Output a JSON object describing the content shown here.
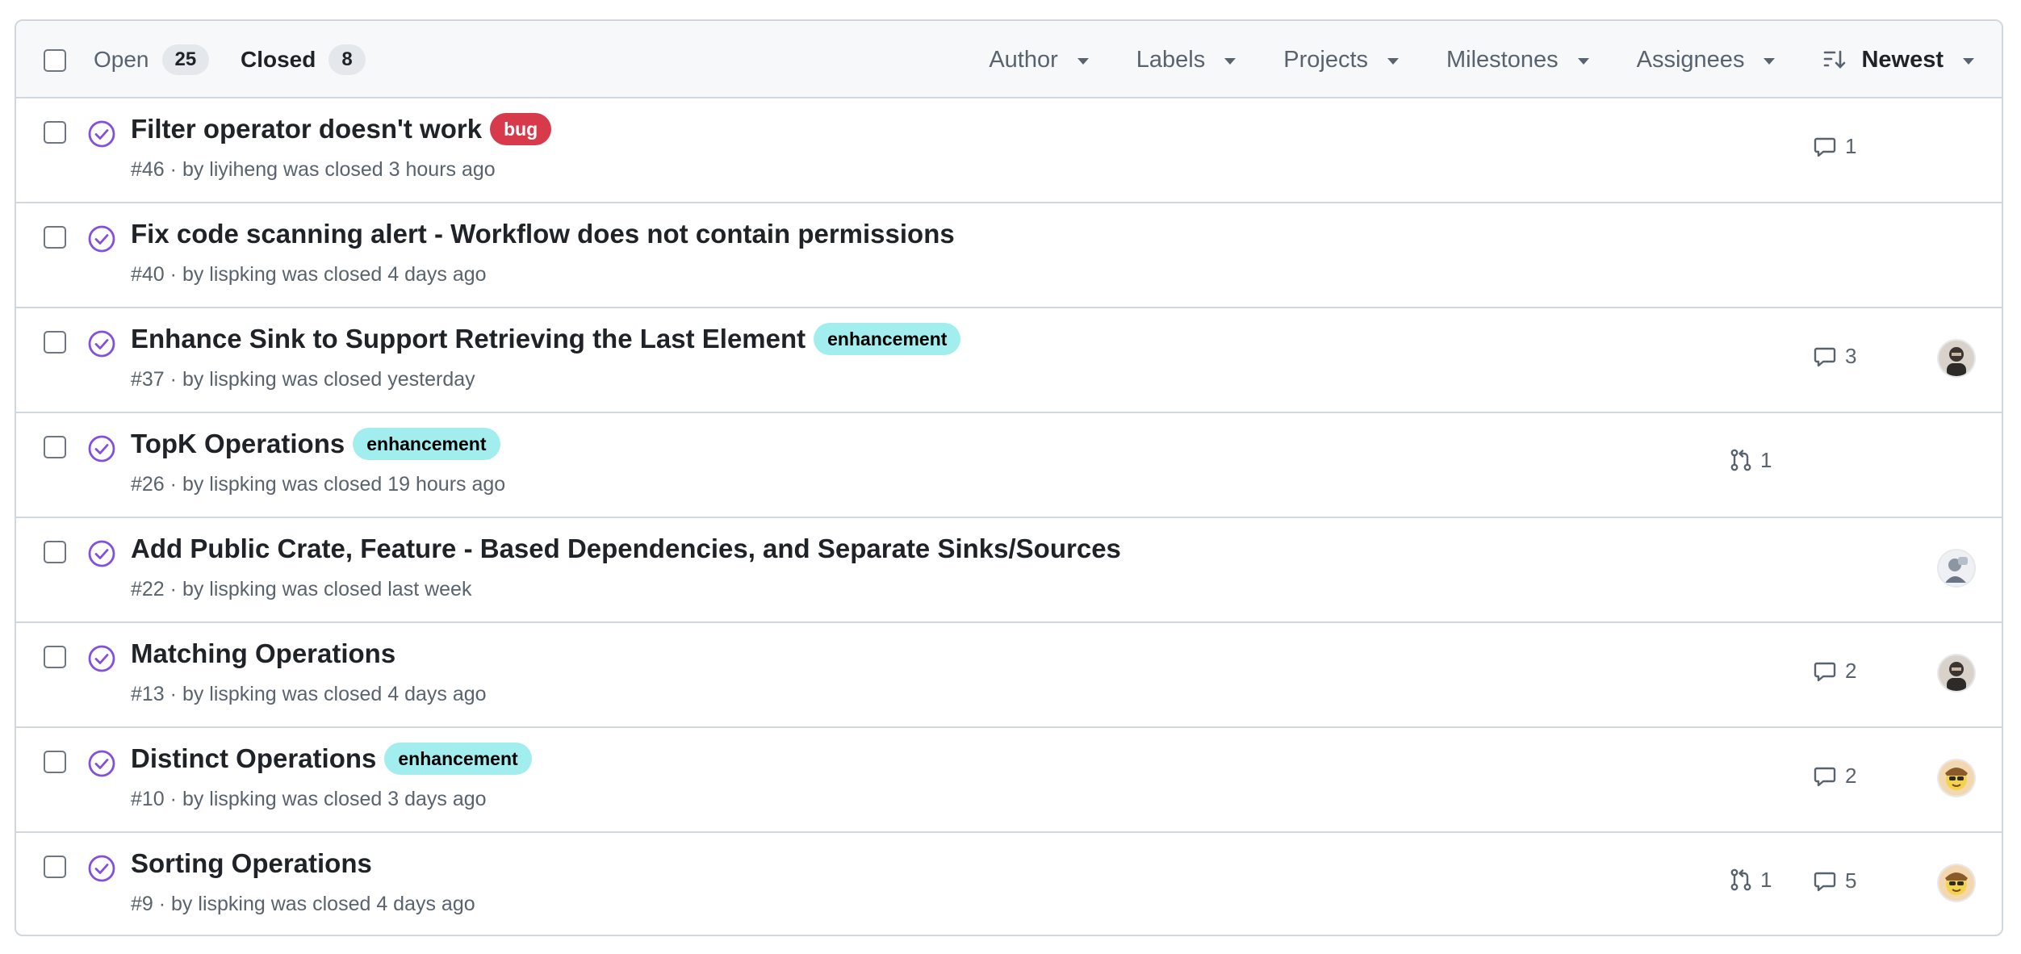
{
  "header": {
    "open": {
      "label": "Open",
      "count": "25"
    },
    "closed": {
      "label": "Closed",
      "count": "8"
    },
    "filters": [
      {
        "label": "Author"
      },
      {
        "label": "Labels"
      },
      {
        "label": "Projects"
      },
      {
        "label": "Milestones"
      },
      {
        "label": "Assignees"
      }
    ],
    "sort": {
      "label": "Newest",
      "icon": "sort-desc-icon"
    }
  },
  "label_colors": {
    "bug": {
      "bg": "#d73a4a",
      "fg": "#ffffff"
    },
    "enhancement": {
      "bg": "#a2eeef",
      "fg": "#000000"
    }
  },
  "status_color": "#8250df",
  "issues": [
    {
      "title": "Filter operator doesn't work",
      "label": "bug",
      "number": "#46",
      "by": "by",
      "author": "liyiheng",
      "closed_text": "was closed 3 hours ago",
      "prs": null,
      "comments": "1",
      "avatar": null
    },
    {
      "title": "Fix code scanning alert - Workflow does not contain permissions",
      "label": null,
      "number": "#40",
      "by": "by",
      "author": "lispking",
      "closed_text": "was closed 4 days ago",
      "prs": null,
      "comments": null,
      "avatar": null
    },
    {
      "title": "Enhance Sink to Support Retrieving the Last Element",
      "label": "enhancement",
      "number": "#37",
      "by": "by",
      "author": "lispking",
      "closed_text": "was closed yesterday",
      "prs": null,
      "comments": "3",
      "avatar": "dark"
    },
    {
      "title": "TopK Operations",
      "label": "enhancement",
      "number": "#26",
      "by": "by",
      "author": "lispking",
      "closed_text": "was closed 19 hours ago",
      "prs": "1",
      "comments": null,
      "avatar": null
    },
    {
      "title": "Add Public Crate, Feature - Based Dependencies, and Separate Sinks/Sources",
      "label": null,
      "number": "#22",
      "by": "by",
      "author": "lispking",
      "closed_text": "was closed last week",
      "prs": null,
      "comments": null,
      "avatar": "grey"
    },
    {
      "title": "Matching Operations",
      "label": null,
      "number": "#13",
      "by": "by",
      "author": "lispking",
      "closed_text": "was closed 4 days ago",
      "prs": null,
      "comments": "2",
      "avatar": "dark"
    },
    {
      "title": "Distinct Operations",
      "label": "enhancement",
      "number": "#10",
      "by": "by",
      "author": "lispking",
      "closed_text": "was closed 3 days ago",
      "prs": null,
      "comments": "2",
      "avatar": "yellow"
    },
    {
      "title": "Sorting Operations",
      "label": null,
      "number": "#9",
      "by": "by",
      "author": "lispking",
      "closed_text": "was closed 4 days ago",
      "prs": "1",
      "comments": "5",
      "avatar": "yellow"
    }
  ]
}
